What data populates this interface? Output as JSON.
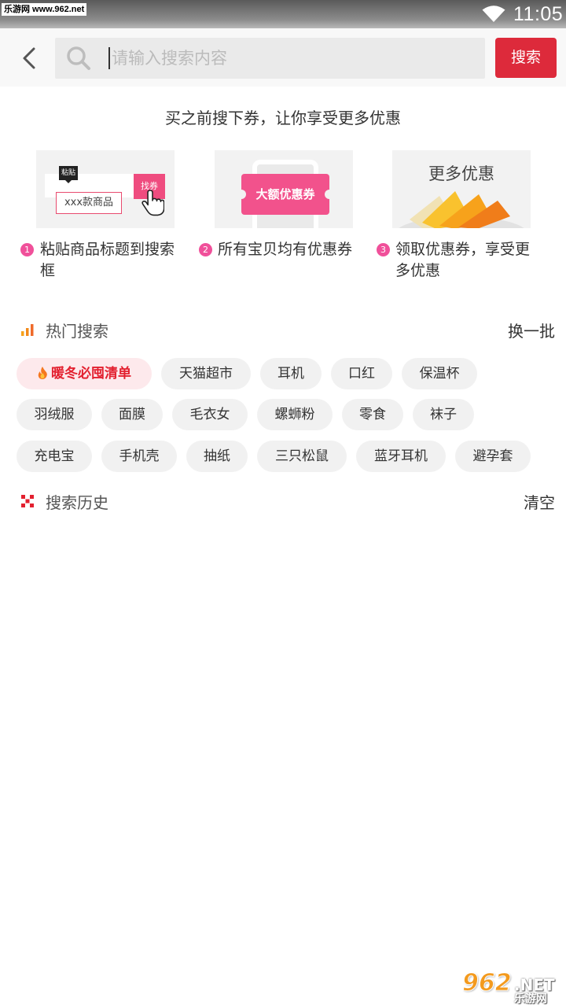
{
  "status_bar": {
    "watermark": "乐游网 www.962.net",
    "time": "11:05"
  },
  "header": {
    "placeholder": "请输入搜索内容",
    "search_label": "搜索"
  },
  "intro": {
    "title": "买之前搜下券，让你享受更多优惠",
    "step1": {
      "num": "1",
      "line1": "粘贴商品标题到搜索",
      "line2": "框",
      "paste_tag": "粘贴",
      "item_label": "xxx款商品",
      "find_label": "找券"
    },
    "step2": {
      "num": "2",
      "line1": "所有宝贝均有优惠券",
      "coupon": "大额优惠券"
    },
    "step3": {
      "num": "3",
      "line1": "领取优惠券，享受更",
      "line2": "多优惠",
      "card_title": "更多优惠"
    }
  },
  "hot_search": {
    "title": "热门搜索",
    "action": "换一批",
    "tags": [
      "暖冬必囤清单",
      "天猫超市",
      "耳机",
      "口红",
      "保温杯",
      "羽绒服",
      "面膜",
      "毛衣女",
      "螺蛳粉",
      "零食",
      "袜子",
      "充电宝",
      "手机壳",
      "抽纸",
      "三只松鼠",
      "蓝牙耳机",
      "避孕套"
    ]
  },
  "history": {
    "title": "搜索历史",
    "action": "清空"
  },
  "watermark_bottom": {
    "num": "962",
    "net": ".NET",
    "cn": "乐游网"
  },
  "colors": {
    "accent": "#dd2a3b",
    "pink": "#f0509a",
    "hot_tag_bg": "#fde9ec"
  }
}
